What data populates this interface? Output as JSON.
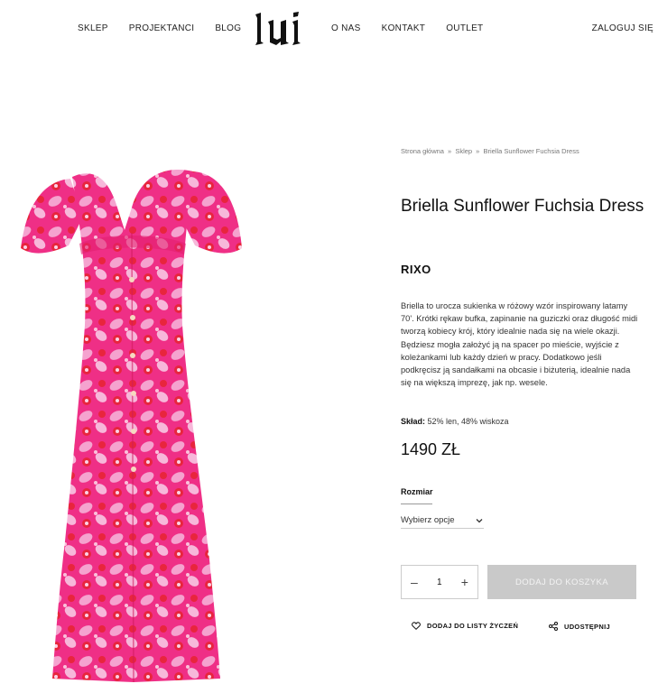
{
  "header": {
    "nav_left": [
      "SKLEP",
      "PROJEKTANCI",
      "BLOG"
    ],
    "nav_right": [
      "O NAS",
      "KONTAKT",
      "OUTLET"
    ],
    "login": "ZALOGUJ SIĘ",
    "logo_text": "lui"
  },
  "breadcrumb": {
    "items": [
      "Strona główna",
      "Sklep",
      "Briella Sunflower Fuchsia Dress"
    ],
    "separator": "»"
  },
  "product": {
    "title": "Briella Sunflower Fuchsia Dress",
    "brand": "RIXO",
    "description": "Briella to urocza sukienka w różowy wzór inspirowany latamy 70'. Krótki rękaw bufka, zapinanie na guziczki oraz długość midi tworzą kobiecy krój, który idealnie nada się na wiele okazji. Będziesz mogła założyć ją na spacer po mieście, wyjście z koleżankami lub każdy dzień w pracy. Dodatkowo jeśli podkręcisz ją sandałkami na obcasie i biżuterią, idealnie nada się na większą imprezę, jak np. wesele.",
    "composition_label": "Skład:",
    "composition_value": " 52% len, 48% wiskoza",
    "price": "1490 ZŁ",
    "size_label": "Rozmiar",
    "size_placeholder": "Wybierz opcje",
    "quantity": "1",
    "add_to_cart": "DODAJ DO KOSZYKA",
    "wishlist": "DODAJ DO LISTY ŻYCZEŃ",
    "share": "UDOSTĘPNIJ"
  },
  "colors": {
    "dress_base": "#ef2f86",
    "dress_light": "#f5a3cf",
    "dress_red": "#e8253d",
    "button_disabled": "#c9c9c9"
  }
}
